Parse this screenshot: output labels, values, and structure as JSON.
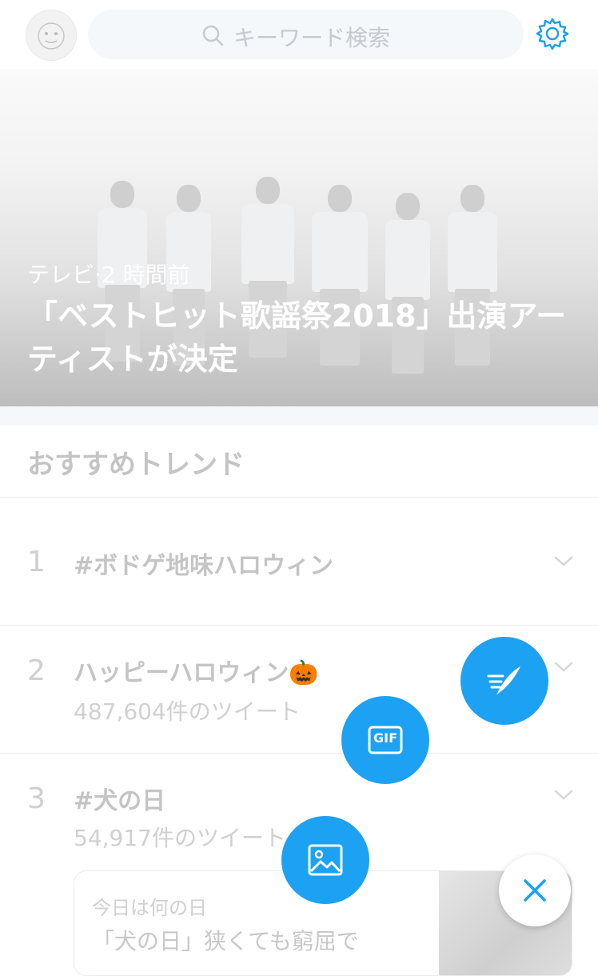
{
  "header": {
    "search_placeholder": "キーワード検索"
  },
  "hero": {
    "meta": "テレビ·2 時間前",
    "title": "「ベストヒット歌謡祭2018」出演アーティストが決定"
  },
  "trends": {
    "section_title": "おすすめトレンド",
    "items": [
      {
        "rank": "1",
        "name": "#ボドゲ地味ハロウィン",
        "count": ""
      },
      {
        "rank": "2",
        "name": "ハッピーハロウィン🎃",
        "count": "487,604件のツイート"
      },
      {
        "rank": "3",
        "name": "#犬の日",
        "count": "54,917件のツイート"
      }
    ],
    "card": {
      "line1": "今日は何の日",
      "line2": "「犬の日」狭くても窮屈で"
    }
  },
  "fab": {
    "compose_icon": "quill-icon",
    "gif_icon": "gif-icon",
    "gif_label": "GIF",
    "image_icon": "image-icon",
    "close_icon": "close-icon"
  },
  "colors": {
    "accent": "#1da1f2",
    "muted_text": "#c4c4c4"
  }
}
